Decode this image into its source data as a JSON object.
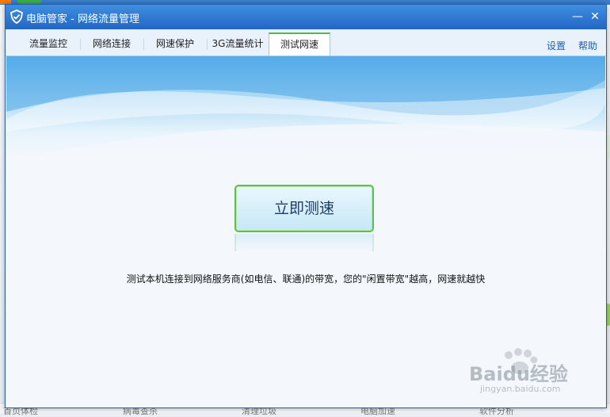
{
  "window": {
    "title": "电脑管家 - 网络流量管理",
    "minimize_glyph": "—",
    "close_glyph": "✕"
  },
  "tabs": [
    {
      "label": "流量监控"
    },
    {
      "label": "网络连接"
    },
    {
      "label": "网速保护"
    },
    {
      "label": "3G流量统计"
    },
    {
      "label": "测试网速"
    }
  ],
  "links": {
    "settings": "设置",
    "help": "帮助"
  },
  "main": {
    "speed_button": "立即测速",
    "description": "测试本机连接到网络服务商(如电信、联通)的带宽，您的\"闲置带宽\"越高，网速就越快"
  },
  "background_bottom": [
    "首页体检",
    "病毒查杀",
    "清理垃圾",
    "电脑加速",
    "软件分析"
  ],
  "watermark": {
    "text": "Baidu经验",
    "sub": "jingyan.baidu.com"
  },
  "colors": {
    "titlebar": "#2e78d4",
    "active_tab_accent": "#5bb34a",
    "link": "#1a5eb8",
    "button_border": "#5cc14a"
  }
}
